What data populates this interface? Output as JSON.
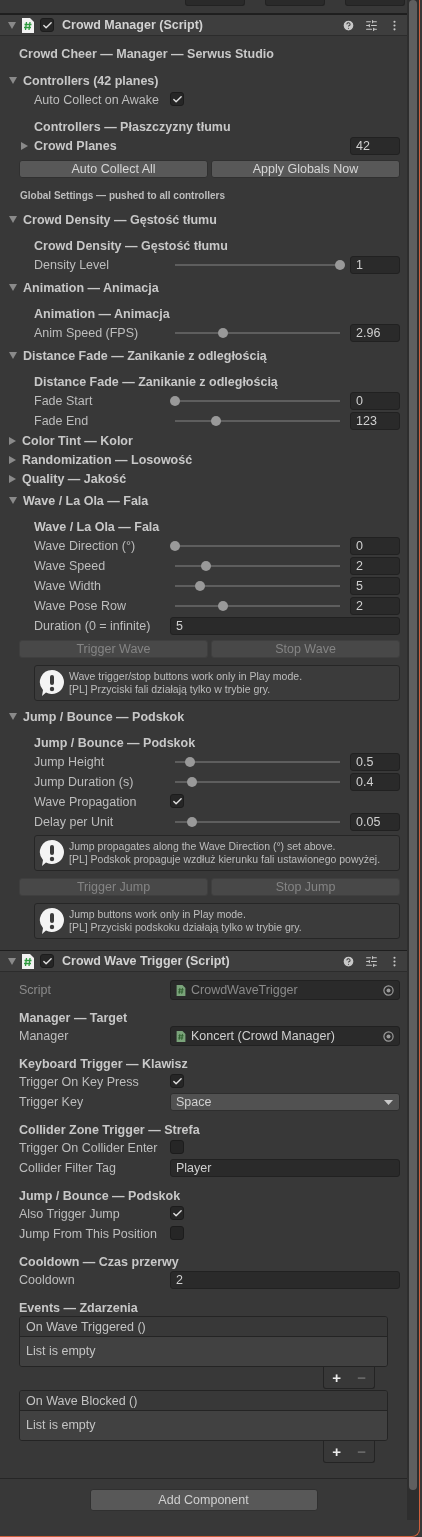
{
  "components": [
    {
      "title": "Crowd Manager (Script)",
      "expanded": true,
      "enabled": true,
      "rows": [
        {
          "kind": "title",
          "text": "Crowd Cheer — Manager — Serwus Studio"
        },
        {
          "kind": "foldout",
          "label": "Controllers (42 planes)",
          "expanded": true,
          "children": [
            {
              "kind": "toggle",
              "label": "Auto Collect on Awake",
              "checked": true
            },
            {
              "kind": "subheader",
              "text": "Controllers — Płaszczyzny tłumu"
            },
            {
              "kind": "list",
              "label": "Crowd Planes",
              "expanded": false,
              "count": "42"
            }
          ]
        },
        {
          "kind": "buttons",
          "buttons": [
            {
              "label": "Auto Collect All",
              "disabled": false
            },
            {
              "label": "Apply Globals Now",
              "disabled": false
            }
          ]
        },
        {
          "kind": "note",
          "text": "Global Settings — pushed to all controllers"
        },
        {
          "kind": "foldout",
          "label": "Crowd Density — Gęstość tłumu",
          "expanded": true,
          "children": [
            {
              "kind": "subheader",
              "text": "Crowd Density — Gęstość tłumu"
            },
            {
              "kind": "slider",
              "label": "Density Level",
              "level": 1,
              "value": "1"
            }
          ]
        },
        {
          "kind": "foldout",
          "label": "Animation — Animacja",
          "expanded": true,
          "children": [
            {
              "kind": "subheader",
              "text": "Animation — Animacja"
            },
            {
              "kind": "slider",
              "label": "Anim Speed (FPS)",
              "level": 0.29,
              "value": "2.96"
            }
          ]
        },
        {
          "kind": "foldout",
          "label": "Distance Fade — Zanikanie z odległością",
          "expanded": true,
          "children": [
            {
              "kind": "subheader",
              "text": "Distance Fade — Zanikanie z odległością"
            },
            {
              "kind": "slider",
              "label": "Fade Start",
              "level": 0,
              "value": "0"
            },
            {
              "kind": "slider",
              "label": "Fade End",
              "level": 0.25,
              "value": "123"
            }
          ]
        },
        {
          "kind": "foldout",
          "label": "Color Tint — Kolor",
          "expanded": false
        },
        {
          "kind": "foldout",
          "label": "Randomization — Losowość",
          "expanded": false
        },
        {
          "kind": "foldout",
          "label": "Quality — Jakość",
          "expanded": false
        },
        {
          "kind": "foldout",
          "label": "Wave / La Ola — Fala",
          "expanded": true,
          "children": [
            {
              "kind": "subheader",
              "text": "Wave / La Ola — Fala"
            },
            {
              "kind": "slider",
              "label": "Wave Direction (°)",
              "level": 0,
              "value": "0"
            },
            {
              "kind": "slider",
              "label": "Wave Speed",
              "level": 0.19,
              "value": "2"
            },
            {
              "kind": "slider",
              "label": "Wave Width",
              "level": 0.15,
              "value": "5"
            },
            {
              "kind": "slider",
              "label": "Wave Pose Row",
              "level": 0.29,
              "value": "2"
            },
            {
              "kind": "field",
              "label": "Duration (0 = infinite)",
              "value": "5"
            },
            {
              "kind": "buttons",
              "buttons": [
                {
                  "label": "Trigger Wave",
                  "disabled": true
                },
                {
                  "label": "Stop Wave",
                  "disabled": true
                }
              ]
            },
            {
              "kind": "help",
              "lines": [
                "Wave trigger/stop buttons work only in Play mode.",
                "[PL] Przyciski fali działają tylko w trybie gry."
              ]
            }
          ]
        },
        {
          "kind": "foldout",
          "label": "Jump / Bounce — Podskok",
          "expanded": true,
          "children": [
            {
              "kind": "subheader",
              "text": "Jump / Bounce — Podskok"
            },
            {
              "kind": "slider",
              "label": "Jump Height",
              "level": 0.09,
              "value": "0.5"
            },
            {
              "kind": "slider",
              "label": "Jump Duration (s)",
              "level": 0.1,
              "value": "0.4"
            },
            {
              "kind": "toggle",
              "label": "Wave Propagation",
              "checked": true
            },
            {
              "kind": "slider",
              "label": "Delay per Unit",
              "level": 0.1,
              "value": "0.05"
            },
            {
              "kind": "help",
              "lines": [
                "Jump propagates along the Wave Direction (°) set above.",
                "[PL] Podskok propaguje wzdłuż kierunku fali ustawionego powyżej."
              ]
            },
            {
              "kind": "buttons",
              "buttons": [
                {
                  "label": "Trigger Jump",
                  "disabled": true
                },
                {
                  "label": "Stop Jump",
                  "disabled": true
                }
              ]
            },
            {
              "kind": "help",
              "lines": [
                "Jump buttons work only in Play mode.",
                "[PL] Przyciski podskoku działają tylko w trybie gry."
              ]
            }
          ]
        }
      ]
    },
    {
      "title": "Crowd Wave Trigger (Script)",
      "expanded": true,
      "enabled": true,
      "rows": [
        {
          "kind": "object",
          "label": "Script",
          "value": "CrowdWaveTrigger",
          "disabled": true
        },
        {
          "kind": "heading",
          "text": "Manager — Target"
        },
        {
          "kind": "object",
          "label": "Manager",
          "value": "Koncert (Crowd Manager)",
          "disabled": false
        },
        {
          "kind": "heading",
          "text": "Keyboard Trigger — Klawisz"
        },
        {
          "kind": "toggle",
          "label": "Trigger On Key Press",
          "checked": true
        },
        {
          "kind": "dropdown",
          "label": "Trigger Key",
          "value": "Space"
        },
        {
          "kind": "heading",
          "text": "Collider Zone Trigger — Strefa"
        },
        {
          "kind": "toggle",
          "label": "Trigger On Collider Enter",
          "checked": false
        },
        {
          "kind": "field",
          "label": "Collider Filter Tag",
          "value": "Player"
        },
        {
          "kind": "heading",
          "text": "Jump / Bounce — Podskok"
        },
        {
          "kind": "toggle",
          "label": "Also Trigger Jump",
          "checked": true
        },
        {
          "kind": "toggle",
          "label": "Jump From This Position",
          "checked": false
        },
        {
          "kind": "heading",
          "text": "Cooldown — Czas przerwy"
        },
        {
          "kind": "field",
          "label": "Cooldown",
          "value": "2"
        },
        {
          "kind": "heading",
          "text": "Events — Zdarzenia"
        },
        {
          "kind": "event",
          "title": "On Wave Triggered ()",
          "empty_text": "List is empty",
          "add": "+",
          "remove": "−"
        },
        {
          "kind": "event",
          "title": "On Wave Blocked ()",
          "empty_text": "List is empty",
          "add": "+",
          "remove": "−"
        }
      ]
    }
  ],
  "add_component": "Add Component"
}
